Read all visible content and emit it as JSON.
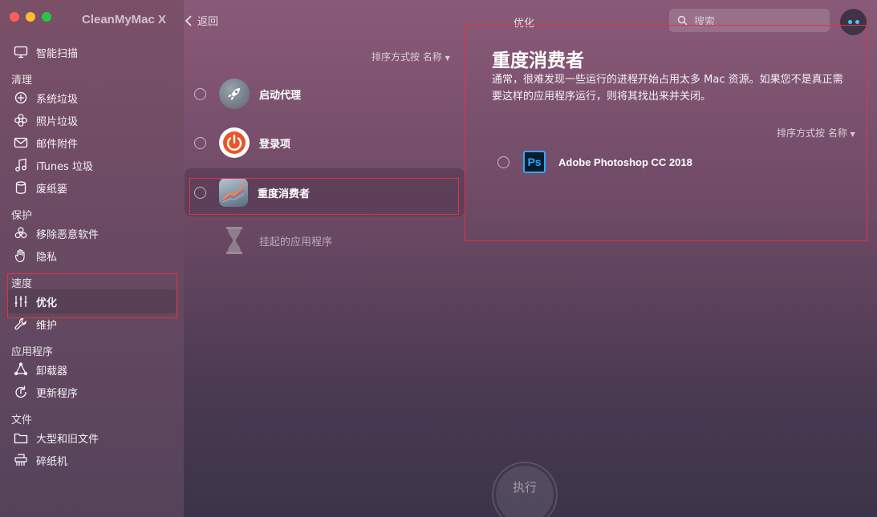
{
  "app": {
    "title": "CleanMyMac X"
  },
  "sidebar": {
    "top_item": {
      "label": "智能扫描",
      "icon": "monitor-icon"
    },
    "sections": [
      {
        "label": "清理",
        "items": [
          {
            "label": "系统垃圾",
            "icon": "system-junk-icon"
          },
          {
            "label": "照片垃圾",
            "icon": "flower-icon"
          },
          {
            "label": "邮件附件",
            "icon": "mail-icon"
          },
          {
            "label": "iTunes 垃圾",
            "icon": "music-note-icon"
          },
          {
            "label": "废纸篓",
            "icon": "trash-icon"
          }
        ]
      },
      {
        "label": "保护",
        "items": [
          {
            "label": "移除恶意软件",
            "icon": "biohazard-icon"
          },
          {
            "label": "隐私",
            "icon": "hand-icon"
          }
        ]
      },
      {
        "label": "速度",
        "items": [
          {
            "label": "优化",
            "icon": "sliders-icon",
            "active": true
          },
          {
            "label": "维护",
            "icon": "wrench-icon"
          }
        ]
      },
      {
        "label": "应用程序",
        "items": [
          {
            "label": "卸载器",
            "icon": "uninstaller-icon"
          },
          {
            "label": "更新程序",
            "icon": "updater-icon"
          }
        ]
      },
      {
        "label": "文件",
        "items": [
          {
            "label": "大型和旧文件",
            "icon": "folder-icon"
          },
          {
            "label": "碎纸机",
            "icon": "shredder-icon"
          }
        ]
      }
    ]
  },
  "toolbar": {
    "back_label": "返回",
    "title": "优化",
    "search_placeholder": "搜索"
  },
  "middle": {
    "sort_label": "排序方式按 名称",
    "items": [
      {
        "label": "启动代理",
        "icon": "rocket-icon"
      },
      {
        "label": "登录项",
        "icon": "power-icon"
      },
      {
        "label": "重度消费者",
        "icon": "chart-icon",
        "selected": true
      },
      {
        "label": "挂起的应用程序",
        "icon": "hourglass-icon",
        "dim": true
      }
    ]
  },
  "detail": {
    "title": "重度消费者",
    "description": "通常，很难发现一些运行的进程开始占用太多 Mac 资源。如果您不是真正需要这样的应用程序运行，则将其找出来并关闭。",
    "sort_label": "排序方式按 名称",
    "apps": [
      {
        "name": "Adobe Photoshop CC 2018",
        "icon_text": "Ps"
      }
    ]
  },
  "run_button": {
    "label": "执行"
  },
  "colors": {
    "highlight": "#e0343c",
    "accent": "#48c8ff",
    "photoshop": "#31a8ff"
  }
}
